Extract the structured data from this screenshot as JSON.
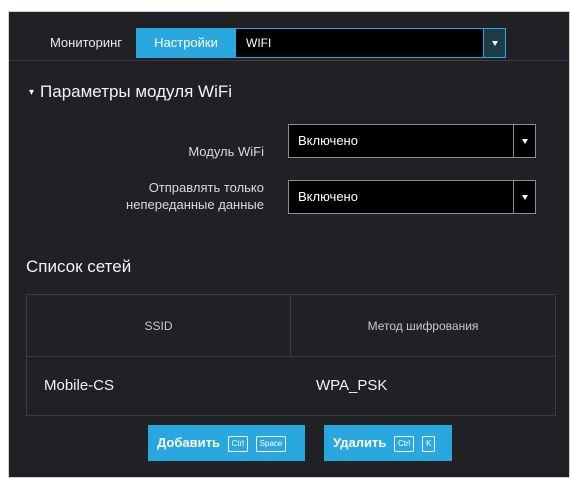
{
  "tabs": {
    "monitoring": "Мониторинг",
    "settings": "Настройки"
  },
  "section_select": {
    "value": "WIFI"
  },
  "params": {
    "title": "Параметры модуля WiFi",
    "wifi_module": {
      "label": "Модуль WiFi",
      "value": "Включено"
    },
    "send_unsent": {
      "label_line1": "Отправлять только",
      "label_line2": "непереданные данные",
      "value": "Включено"
    }
  },
  "networks": {
    "title": "Список сетей",
    "columns": [
      "SSID",
      "Метод шифрования"
    ],
    "rows": [
      {
        "ssid": "Mobile-CS",
        "encryption": "WPA_PSK"
      }
    ]
  },
  "buttons": {
    "add": {
      "label": "Добавить",
      "keys": [
        "Ctrl",
        "Space"
      ]
    },
    "delete": {
      "label": "Удалить",
      "keys": [
        "Ctrl",
        "K"
      ]
    }
  },
  "colors": {
    "accent": "#29a8df",
    "panel_bg": "#1f2124",
    "field_bg": "#000000"
  },
  "icons": {
    "collapse": "triangle-down-icon",
    "dropdown": "chevron-down-icon"
  }
}
